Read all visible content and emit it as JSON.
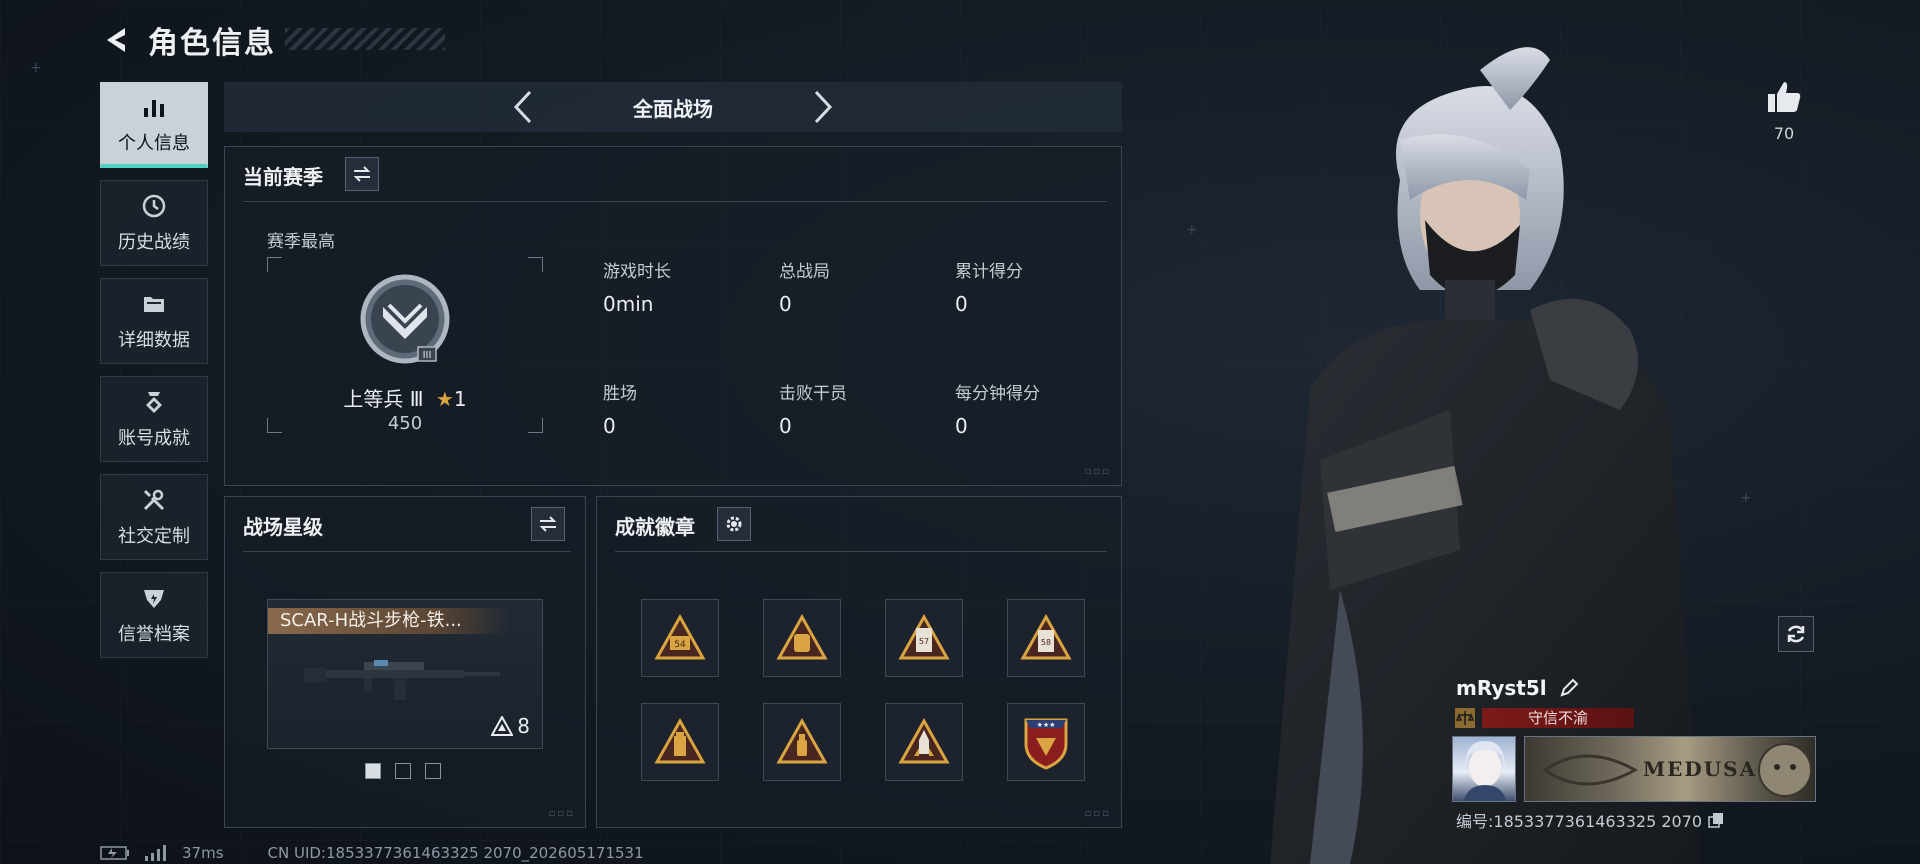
{
  "header": {
    "title": "角色信息"
  },
  "nav": {
    "items": [
      {
        "label": "个人信息",
        "icon": "bar-chart-icon",
        "active": true
      },
      {
        "label": "历史战绩",
        "icon": "clock-history-icon",
        "active": false
      },
      {
        "label": "详细数据",
        "icon": "folder-icon",
        "active": false
      },
      {
        "label": "账号成就",
        "icon": "medal-icon",
        "active": false
      },
      {
        "label": "社交定制",
        "icon": "tools-icon",
        "active": false
      },
      {
        "label": "信誉档案",
        "icon": "shield-icon",
        "active": false
      }
    ]
  },
  "mode_bar": {
    "label": "全面战场"
  },
  "season": {
    "title": "当前赛季",
    "best_label": "赛季最高",
    "rank_name": "上等兵 Ⅲ",
    "rank_stars": "1",
    "rank_points": "450",
    "stats": [
      {
        "key": "游戏时长",
        "value": "0min"
      },
      {
        "key": "总战局",
        "value": "0"
      },
      {
        "key": "累计得分",
        "value": "0"
      },
      {
        "key": "胜场",
        "value": "0"
      },
      {
        "key": "击败干员",
        "value": "0"
      },
      {
        "key": "每分钟得分",
        "value": "0"
      }
    ]
  },
  "battlefield": {
    "title": "战场星级",
    "weapon_name": "SCAR-H战斗步枪-铁...",
    "weapon_level": "8"
  },
  "achievements": {
    "title": "成就徽章",
    "badges": [
      "triangle-badge-54",
      "triangle-badge-bag",
      "triangle-badge-57",
      "triangle-badge-58",
      "triangle-badge-tower",
      "triangle-badge-bottle",
      "triangle-badge-rocket",
      "shield-badge-stars"
    ],
    "badge_labels": [
      "54",
      "57",
      "58"
    ]
  },
  "profile": {
    "likes": "70",
    "player_name": "mRyst5l",
    "honor_title": "守信不渝",
    "banner_text": "MEDUSA",
    "id_label": "编号:1853377361463325 2070",
    "uid_text": "CN UID:1853377361463325 2070_202605171531",
    "ping": "37ms"
  },
  "colors": {
    "accent": "#4fd1c5",
    "honor": "#7d1a1a",
    "gold": "#d9a441"
  }
}
